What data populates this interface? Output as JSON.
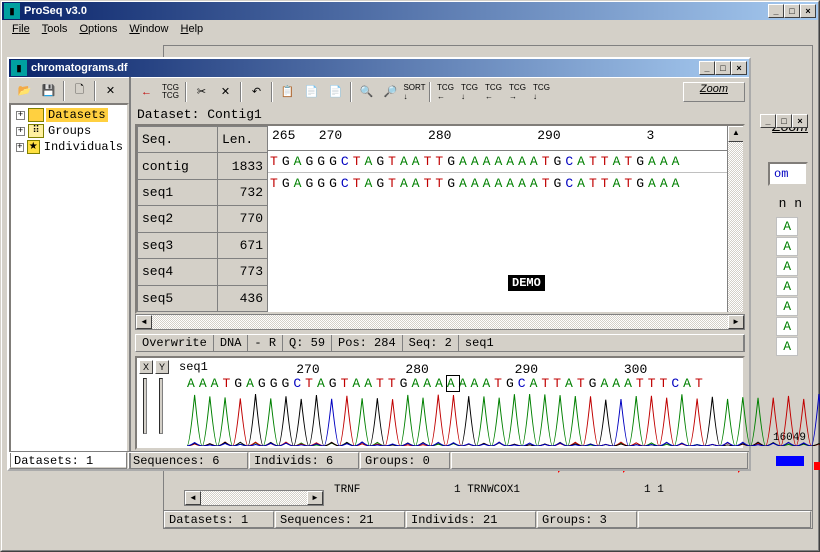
{
  "app": {
    "title": "ProSeq v3.0"
  },
  "menus": [
    "File",
    "Tools",
    "Options",
    "Window",
    "Help"
  ],
  "doc": {
    "title": "chromatograms.df"
  },
  "tree": {
    "items": [
      {
        "label": "Datasets",
        "icon": "folder",
        "selected": true
      },
      {
        "label": "Groups",
        "icon": "grp",
        "selected": false
      },
      {
        "label": "Individuals",
        "icon": "ind",
        "selected": false
      }
    ]
  },
  "zoom_label": "Zoom",
  "dataset_label": "Dataset: Contig1",
  "seq_headers": {
    "name": "Seq.",
    "len": "Len."
  },
  "ruler": {
    "start": 265,
    "ticks": [
      265,
      270,
      280,
      290
    ]
  },
  "sequences": [
    {
      "name": "contig",
      "len": 1833,
      "bases": "TGAGGGCTAGTAATTGAAAAAAATGCATTATGAAA"
    },
    {
      "name": "seq1",
      "len": 732,
      "bases": "TGAGGGCTAGTAATTGAAAAAAATGCATTATGAAA"
    },
    {
      "name": "seq2",
      "len": 770,
      "bases": ""
    },
    {
      "name": "seq3",
      "len": 671,
      "bases": ""
    },
    {
      "name": "seq4",
      "len": 773,
      "bases": ""
    },
    {
      "name": "seq5",
      "len": 436,
      "bases": ""
    }
  ],
  "demo": "DEMO",
  "info": {
    "mode": "Overwrite",
    "type": "DNA",
    "r": "- R",
    "q": "Q: 59",
    "pos": "Pos: 284",
    "seq": "Seq: 2",
    "name": "seq1"
  },
  "chrom": {
    "label": "seq1",
    "ticks": [
      270,
      280,
      290,
      300
    ],
    "bases": "AAATGAGGGCTAGTAATTGAAAAAAATGCATTATGAAATTTCAT",
    "highlight_index": 22
  },
  "status_front": {
    "datasets": "Datasets: 1",
    "sequences": "Sequences: 6",
    "individs": "Individs: 6",
    "groups": "Groups: 0"
  },
  "bg": {
    "zoom": "Zoom",
    "nn": "n n",
    "col": [
      "A",
      "A",
      "A",
      "A",
      "A",
      "A",
      "A"
    ],
    "num": "16049",
    "trnf": "TRNF",
    "trnw": "1 TRNWCOX1",
    "one": "1 1",
    "status": {
      "datasets": "Datasets: 1",
      "sequences": "Sequences: 21",
      "individs": "Individs: 21",
      "groups": "Groups: 3"
    }
  }
}
